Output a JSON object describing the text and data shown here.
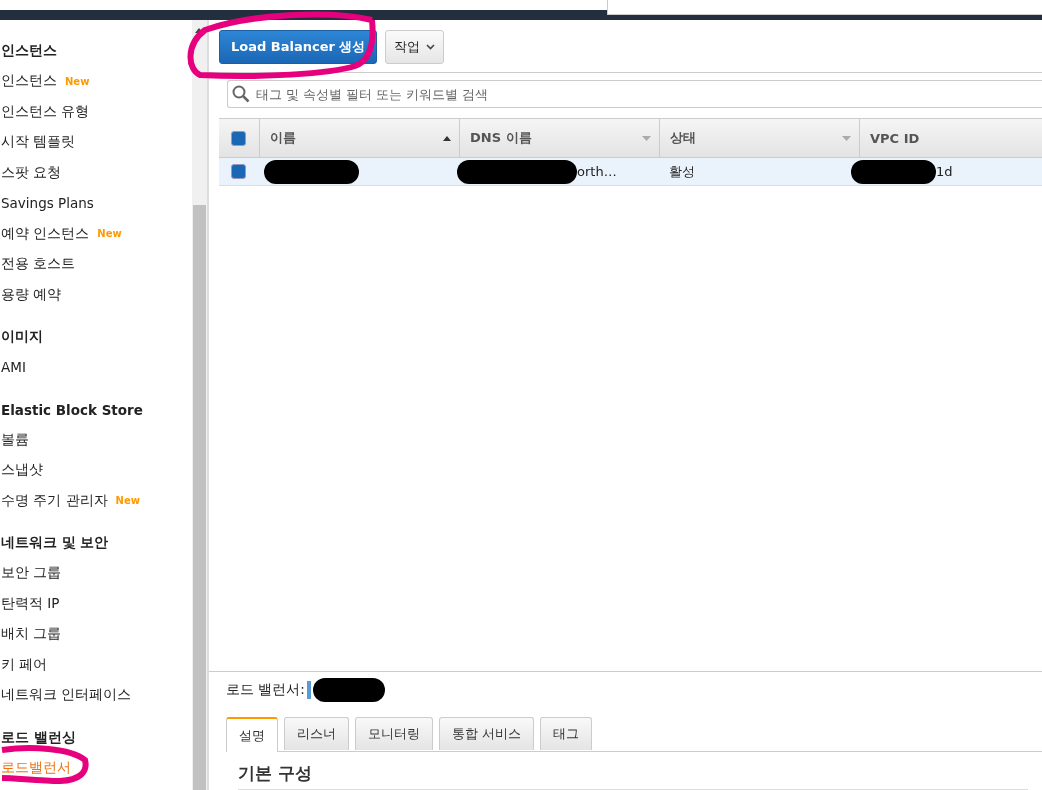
{
  "sidebar": {
    "sections": [
      {
        "heading": "인스턴스",
        "items": [
          {
            "label": "인스턴스",
            "badge": "New",
            "selected": false
          },
          {
            "label": "인스턴스 유형",
            "selected": false
          },
          {
            "label": "시작 템플릿",
            "selected": false
          },
          {
            "label": "스팟 요청",
            "selected": false
          },
          {
            "label": "Savings Plans",
            "selected": false
          },
          {
            "label": "예약 인스턴스",
            "badge": "New",
            "selected": false
          },
          {
            "label": "전용 호스트",
            "selected": false
          },
          {
            "label": "용량 예약",
            "selected": false
          }
        ]
      },
      {
        "heading": "이미지",
        "items": [
          {
            "label": "AMI",
            "selected": false
          }
        ]
      },
      {
        "heading": "Elastic Block Store",
        "items": [
          {
            "label": "볼륨",
            "selected": false
          },
          {
            "label": "스냅샷",
            "selected": false
          },
          {
            "label": "수명 주기 관리자",
            "badge": "New",
            "selected": false
          }
        ]
      },
      {
        "heading": "네트워크 및 보안",
        "items": [
          {
            "label": "보안 그룹",
            "selected": false
          },
          {
            "label": "탄력적 IP",
            "selected": false
          },
          {
            "label": "배치 그룹",
            "selected": false
          },
          {
            "label": "키 페어",
            "selected": false
          },
          {
            "label": "네트워크 인터페이스",
            "selected": false
          }
        ]
      },
      {
        "heading": "로드 밸런싱",
        "items": [
          {
            "label": "로드밸런서",
            "selected": true
          }
        ]
      }
    ]
  },
  "toolbar": {
    "create_button": "Load Balancer 생성",
    "actions_button": "작업"
  },
  "search": {
    "placeholder": "태그 및 속성별 필터 또는 키워드별 검색"
  },
  "table": {
    "header_checked": true,
    "columns": [
      {
        "label": "이름",
        "kind": "sorted"
      },
      {
        "label": "DNS 이름",
        "kind": "menu"
      },
      {
        "label": "상태",
        "kind": "menu"
      },
      {
        "label": "VPC ID",
        "kind": "plain"
      }
    ],
    "rows": [
      {
        "selected": true,
        "checked": true,
        "cells": [
          {
            "redacted": true
          },
          {
            "text": "orth…",
            "redacted": true
          },
          {
            "text": "활성",
            "redacted": false
          },
          {
            "text": "1d",
            "redacted": true
          }
        ]
      }
    ]
  },
  "details": {
    "label": "로드 밸런서:",
    "value_redacted": true,
    "tabs": [
      {
        "label": "설명",
        "selected": true
      },
      {
        "label": "리스너",
        "selected": false
      },
      {
        "label": "모니터링",
        "selected": false
      },
      {
        "label": "통합 서비스",
        "selected": false
      },
      {
        "label": "태그",
        "selected": false
      }
    ],
    "section_heading": "기본 구성"
  }
}
